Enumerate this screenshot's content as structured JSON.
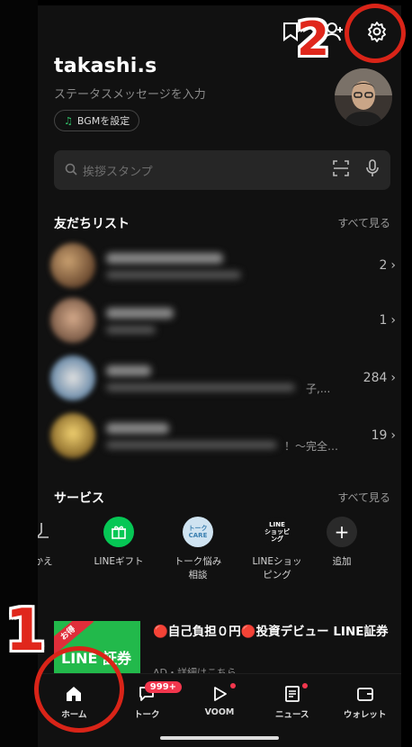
{
  "profile": {
    "username": "takashi.s",
    "status_placeholder": "ステータスメッセージを入力",
    "bgm_label": "BGMを設定"
  },
  "search": {
    "placeholder": "挨拶スタンプ"
  },
  "friends": {
    "title": "友だちリスト",
    "see_all": "すべて見る",
    "rows": [
      {
        "count": "2"
      },
      {
        "count": "1"
      },
      {
        "count": "284",
        "snippet": "子,..."
      },
      {
        "count": "19",
        "snippet": "！〜完全…"
      }
    ]
  },
  "services": {
    "title": "サービス",
    "see_all": "すべて見る",
    "items": [
      {
        "label": "かえ"
      },
      {
        "label": "LINEギフト"
      },
      {
        "label": "トーク悩み\n相談",
        "icon_text": "トーク\nCARE"
      },
      {
        "label": "LINEショッ\nピング",
        "icon_text": "LINE\nショッピング"
      },
      {
        "label": "追加"
      }
    ]
  },
  "ad": {
    "ribbon": "お得",
    "brand": "LINE 証券",
    "title": "🔴自己負担０円🔴投資デビュー LINE証券",
    "sub": "AD・詳細はこちら"
  },
  "nav": {
    "items": [
      {
        "label": "ホーム"
      },
      {
        "label": "トーク",
        "badge": "999+"
      },
      {
        "label": "VOOM"
      },
      {
        "label": "ニュース"
      },
      {
        "label": "ウォレット"
      }
    ]
  },
  "annotations": {
    "one": "1",
    "two": "2"
  },
  "colors": {
    "accent_green": "#06c755",
    "annotation_red": "#d92418",
    "badge_red": "#f2364d"
  }
}
